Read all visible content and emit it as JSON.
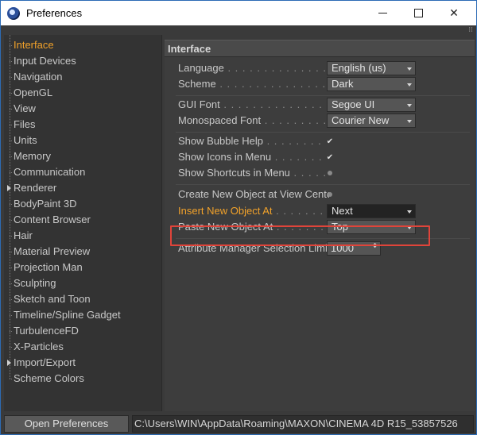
{
  "window": {
    "title": "Preferences",
    "minimize_glyph": "",
    "maximize_glyph": "",
    "close_glyph": "✕"
  },
  "sidebar": {
    "items": [
      {
        "label": "Interface",
        "active": true
      },
      {
        "label": "Input Devices"
      },
      {
        "label": "Navigation"
      },
      {
        "label": "OpenGL"
      },
      {
        "label": "View"
      },
      {
        "label": "Files"
      },
      {
        "label": "Units"
      },
      {
        "label": "Memory"
      },
      {
        "label": "Communication"
      },
      {
        "label": "Renderer",
        "expandable": true
      },
      {
        "label": "BodyPaint 3D"
      },
      {
        "label": "Content Browser"
      },
      {
        "label": "Hair"
      },
      {
        "label": "Material Preview"
      },
      {
        "label": "Projection Man"
      },
      {
        "label": "Sculpting"
      },
      {
        "label": "Sketch and Toon"
      },
      {
        "label": "Timeline/Spline Gadget"
      },
      {
        "label": "TurbulenceFD"
      },
      {
        "label": "X-Particles"
      },
      {
        "label": "Import/Export",
        "expandable": true
      },
      {
        "label": "Scheme Colors"
      }
    ]
  },
  "panel": {
    "header": "Interface",
    "language": {
      "label": "Language",
      "value": "English (us)"
    },
    "scheme": {
      "label": "Scheme",
      "value": "Dark"
    },
    "gui_font": {
      "label": "GUI Font",
      "value": "Segoe UI"
    },
    "mono_font": {
      "label": "Monospaced Font",
      "value": "Courier New"
    },
    "bubble_help": {
      "label": "Show Bubble Help",
      "checked": true,
      "mark": "✔"
    },
    "icons_in_menu": {
      "label": "Show Icons in Menu",
      "checked": true,
      "mark": "✔"
    },
    "shortcuts_in_menu": {
      "label": "Show Shortcuts in Menu",
      "checked": false
    },
    "create_at_center": {
      "label": "Create New Object at View Center",
      "checked": false
    },
    "insert_new_object": {
      "label": "Insert New Object At",
      "value": "Next"
    },
    "paste_new_object": {
      "label": "Paste New Object At",
      "value": "Top"
    },
    "attr_limit": {
      "label": "Attribute Manager Selection Limit",
      "value": "1000",
      "spin_glyph": "⬍"
    }
  },
  "footer": {
    "open_folder_label": "Open Preferences Folder...",
    "path": "C:\\Users\\WIN\\AppData\\Roaming\\MAXON\\CINEMA 4D R15_53857526"
  },
  "colors": {
    "accent_orange": "#f2a22a",
    "highlight_box": "#e0443a",
    "panel_bg": "#3d3d3d"
  }
}
